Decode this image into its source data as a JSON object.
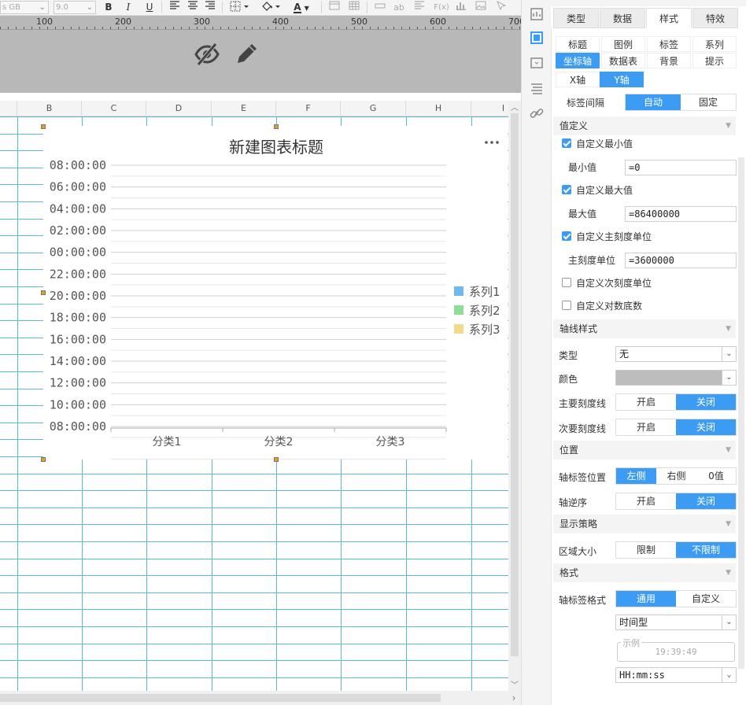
{
  "toolbar": {
    "font_name": "s GB",
    "font_size": "9.0",
    "bold": "B",
    "italic": "I",
    "underline": "U",
    "font_color": "A",
    "text_ab": "ab",
    "formula": "F(x)"
  },
  "ruler": {
    "labels": [
      "100",
      "200",
      "300",
      "400",
      "500",
      "600",
      "700"
    ]
  },
  "sheet": {
    "columns": [
      "B",
      "C",
      "D",
      "E",
      "F",
      "G",
      "H",
      "I"
    ]
  },
  "chart_data": {
    "type": "bar",
    "title": "新建图表标题",
    "categories": [
      "分类1",
      "分类2",
      "分类3"
    ],
    "series": [
      {
        "name": "系列1",
        "color": "#6fb9f0",
        "values": []
      },
      {
        "name": "系列2",
        "color": "#8fdd96",
        "values": []
      },
      {
        "name": "系列3",
        "color": "#f5d98a",
        "values": []
      }
    ],
    "y_tick_labels": [
      "08:00:00",
      "06:00:00",
      "04:00:00",
      "02:00:00",
      "00:00:00",
      "22:00:00",
      "20:00:00",
      "18:00:00",
      "16:00:00",
      "14:00:00",
      "12:00:00",
      "10:00:00",
      "08:00:00"
    ],
    "ylim": [
      0,
      86400000
    ],
    "y_major_unit": 3600000,
    "grid": true,
    "legend_position": "right",
    "more_icon": "ellipsis-icon"
  },
  "panel": {
    "main_tabs": [
      "类型",
      "数据",
      "样式",
      "特效"
    ],
    "active_main_tab": "样式",
    "sub_tabs_row1": [
      "标题",
      "图例",
      "标签",
      "系列"
    ],
    "sub_tabs_row2": [
      "坐标轴",
      "数据表",
      "背景",
      "提示"
    ],
    "axis_tabs": [
      "X轴",
      "Y轴"
    ],
    "label_interval": {
      "label": "标签间隔",
      "options": [
        "自动",
        "固定"
      ],
      "selected": "自动"
    },
    "value_def": {
      "title": "值定义",
      "custom_min": {
        "label": "自定义最小值",
        "checked": true
      },
      "min_label": "最小值",
      "min_value": "=0",
      "custom_max": {
        "label": "自定义最大值",
        "checked": true
      },
      "max_label": "最大值",
      "max_value": "=86400000",
      "custom_major": {
        "label": "自定义主刻度单位",
        "checked": true
      },
      "major_label": "主刻度单位",
      "major_value": "=3600000",
      "custom_minor": {
        "label": "自定义次刻度单位",
        "checked": false
      },
      "custom_log": {
        "label": "自定义对数底数",
        "checked": false
      }
    },
    "axis_style": {
      "title": "轴线样式",
      "type_label": "类型",
      "type_value": "无",
      "color_label": "颜色",
      "color_value": "#bdbdbd",
      "major_tick_label": "主要刻度线",
      "minor_tick_label": "次要刻度线",
      "on_off": [
        "开启",
        "关闭"
      ],
      "major_tick_selected": "关闭",
      "minor_tick_selected": "关闭"
    },
    "position": {
      "title": "位置",
      "label_pos_label": "轴标签位置",
      "label_pos_options": [
        "左侧",
        "右侧",
        "0值"
      ],
      "label_pos_selected": "左侧",
      "reverse_label": "轴逆序",
      "reverse_options": [
        "开启",
        "关闭"
      ],
      "reverse_selected": "关闭"
    },
    "display": {
      "title": "显示策略",
      "area_label": "区域大小",
      "area_options": [
        "限制",
        "不限制"
      ],
      "area_selected": "不限制"
    },
    "format": {
      "title": "格式",
      "label_format_label": "轴标签格式",
      "options": [
        "通用",
        "自定义"
      ],
      "selected": "通用",
      "type_value": "时间型",
      "example_label": "示例",
      "example_value": "19:39:49",
      "pattern_value": "HH:mm:ss"
    }
  },
  "colors": {
    "accent": "#3c9cf3",
    "grid_line": "#5bbcd1",
    "ruler_bg": "#b8b8b8"
  }
}
